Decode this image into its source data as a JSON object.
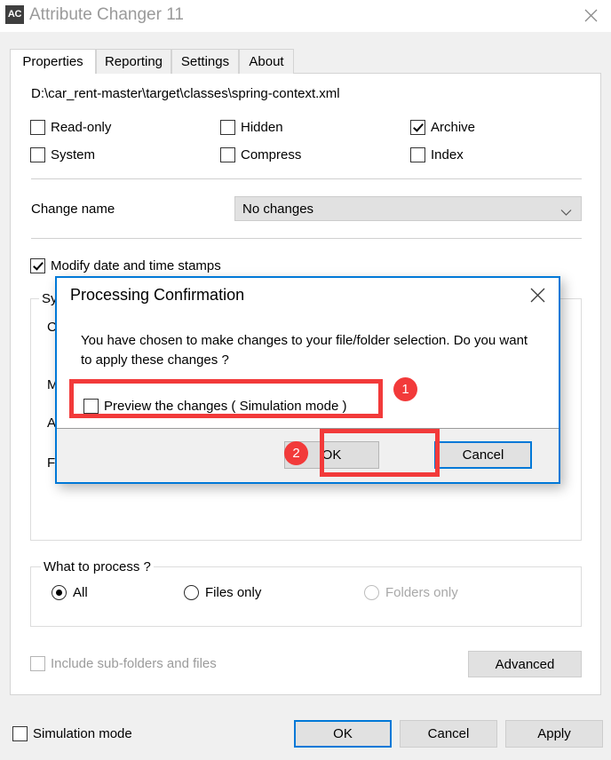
{
  "window": {
    "icon_text": "AC",
    "title": "Attribute Changer 11",
    "close_icon": "close-icon"
  },
  "tabs": [
    {
      "label": "Properties",
      "active": true
    },
    {
      "label": "Reporting",
      "active": false
    },
    {
      "label": "Settings",
      "active": false
    },
    {
      "label": "About",
      "active": false
    }
  ],
  "properties": {
    "file_path": "D:\\car_rent-master\\target\\classes\\spring-context.xml",
    "attributes": [
      {
        "label": "Read-only",
        "checked": false
      },
      {
        "label": "Hidden",
        "checked": false
      },
      {
        "label": "Archive",
        "checked": true
      },
      {
        "label": "System",
        "checked": false
      },
      {
        "label": "Compress",
        "checked": false
      },
      {
        "label": "Index",
        "checked": false
      }
    ],
    "change_name": {
      "label": "Change name",
      "value": "No changes",
      "chevron_icon": "chevron-down-icon"
    },
    "modify_stamps": {
      "label": "Modify date and time stamps",
      "checked": true
    },
    "stamps_group": {
      "legend": "Sy:",
      "rows": [
        "C",
        "M",
        "A",
        "F"
      ]
    },
    "what_to_process": {
      "legend": "What to process ?",
      "options": [
        {
          "label": "All",
          "selected": true,
          "disabled": false
        },
        {
          "label": "Files only",
          "selected": false,
          "disabled": false
        },
        {
          "label": "Folders only",
          "selected": false,
          "disabled": true
        }
      ]
    },
    "include_subfolders": {
      "label": "Include sub-folders and files",
      "checked": false,
      "disabled": true
    },
    "advanced_button": "Advanced"
  },
  "footer": {
    "simulation_mode": {
      "label": "Simulation mode",
      "checked": false
    },
    "ok": "OK",
    "cancel": "Cancel",
    "apply": "Apply"
  },
  "dialog": {
    "title": "Processing Confirmation",
    "close_icon": "close-icon",
    "message": "You have chosen to make changes to your file/folder selection.  Do you want to apply these changes ?",
    "preview_checkbox": {
      "label": "Preview the changes ( Simulation mode )",
      "checked": false
    },
    "ok": "OK",
    "cancel": "Cancel"
  },
  "annotations": [
    {
      "badge": "1",
      "target": "preview-checkbox"
    },
    {
      "badge": "2",
      "target": "dialog-ok-button"
    }
  ],
  "colors": {
    "accent_blue": "#0078d7",
    "annotation_red": "#f23a3a",
    "title_gray": "#9a9a9a",
    "control_gray": "#e1e1e1"
  }
}
